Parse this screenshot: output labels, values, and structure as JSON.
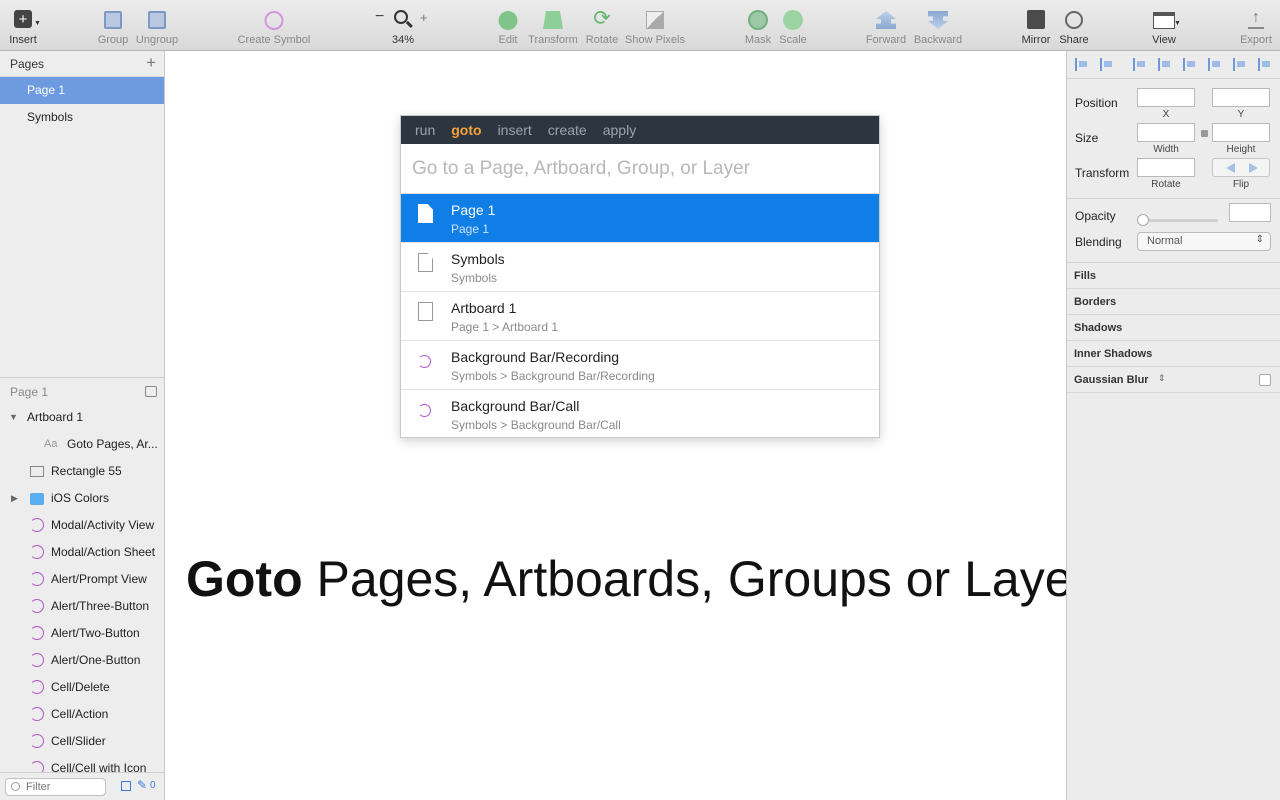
{
  "toolbar": {
    "insert": "Insert",
    "group": "Group",
    "ungroup": "Ungroup",
    "create_symbol": "Create Symbol",
    "zoom": "34%",
    "edit": "Edit",
    "transform": "Transform",
    "rotate": "Rotate",
    "show_pixels": "Show Pixels",
    "mask": "Mask",
    "scale": "Scale",
    "forward": "Forward",
    "backward": "Backward",
    "mirror": "Mirror",
    "share": "Share",
    "view": "View",
    "export": "Export"
  },
  "pages": {
    "header": "Pages",
    "items": [
      {
        "label": "Page 1"
      },
      {
        "label": "Symbols"
      }
    ]
  },
  "layers": {
    "header": "Page 1",
    "items": [
      {
        "label": "Artboard 1"
      },
      {
        "label": "Goto Pages, Ar..."
      },
      {
        "label": "Rectangle 55"
      },
      {
        "label": "iOS Colors"
      },
      {
        "label": "Modal/Activity View"
      },
      {
        "label": "Modal/Action Sheet"
      },
      {
        "label": "Alert/Prompt View"
      },
      {
        "label": "Alert/Three-Button"
      },
      {
        "label": "Alert/Two-Button"
      },
      {
        "label": "Alert/One-Button"
      },
      {
        "label": "Cell/Delete"
      },
      {
        "label": "Cell/Action"
      },
      {
        "label": "Cell/Slider"
      },
      {
        "label": "Cell/Cell with Icon"
      }
    ],
    "filter_placeholder": "Filter",
    "filter_count": "0"
  },
  "palette": {
    "tabs": [
      {
        "label": "run"
      },
      {
        "label": "goto"
      },
      {
        "label": "insert"
      },
      {
        "label": "create"
      },
      {
        "label": "apply"
      }
    ],
    "placeholder": "Go to a Page, Artboard, Group, or Layer",
    "results": [
      {
        "title": "Page 1",
        "path": "Page 1"
      },
      {
        "title": "Symbols",
        "path": "Symbols"
      },
      {
        "title": "Artboard 1",
        "path": "Page 1 > Artboard 1"
      },
      {
        "title": "Background Bar/Recording",
        "path": "Symbols > Background Bar/Recording"
      },
      {
        "title": "Background Bar/Call",
        "path": "Symbols > Background Bar/Call"
      }
    ]
  },
  "headline": {
    "bold": "Goto",
    "rest": " Pages, Artboards, Groups or Layers"
  },
  "inspector": {
    "position": "Position",
    "x": "X",
    "y": "Y",
    "size": "Size",
    "width": "Width",
    "height": "Height",
    "transform": "Transform",
    "rotate": "Rotate",
    "flip": "Flip",
    "opacity": "Opacity",
    "blending": "Blending",
    "blending_value": "Normal",
    "sections": [
      {
        "label": "Fills"
      },
      {
        "label": "Borders"
      },
      {
        "label": "Shadows"
      },
      {
        "label": "Inner Shadows"
      },
      {
        "label": "Gaussian Blur"
      }
    ]
  },
  "colors": {
    "selection": "#0f7ee6",
    "page_selection": "#6e9ae0",
    "palette_header": "#2d3540",
    "active_tab": "#f6a23b",
    "symbol_icon": "#b455c9"
  }
}
